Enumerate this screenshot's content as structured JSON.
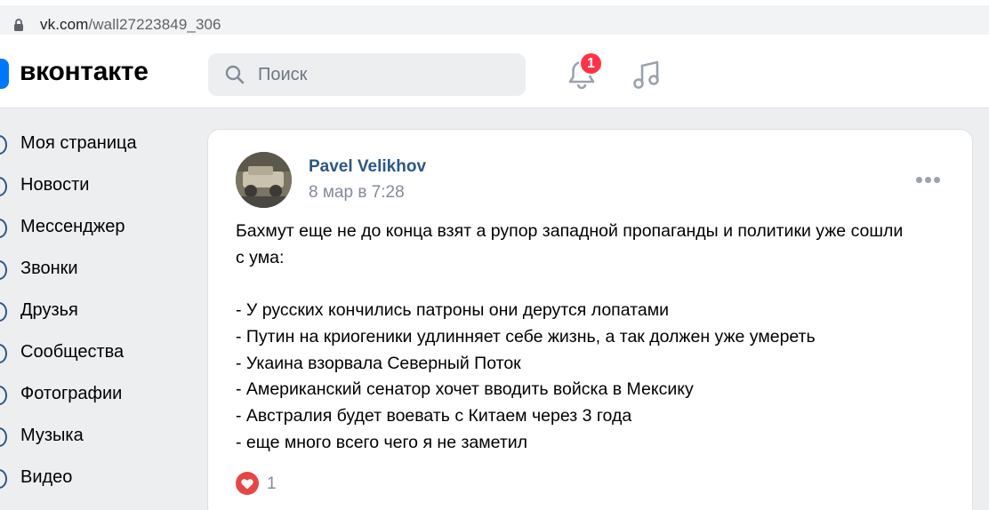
{
  "browser": {
    "url_domain": "vk.com",
    "url_path": "/wall27223849_306"
  },
  "header": {
    "logo_text": "вконтакте",
    "search_placeholder": "Поиск",
    "notifications_badge": "1"
  },
  "sidebar": {
    "items": [
      {
        "label": "Моя страница"
      },
      {
        "label": "Новости"
      },
      {
        "label": "Мессенджер"
      },
      {
        "label": "Звонки"
      },
      {
        "label": "Друзья"
      },
      {
        "label": "Сообщества"
      },
      {
        "label": "Фотографии"
      },
      {
        "label": "Музыка"
      },
      {
        "label": "Видео"
      }
    ]
  },
  "post": {
    "author": "Pavel Velikhov",
    "time": "8 мар в 7:28",
    "lines": [
      "Бахмут еще не до конца взят а рупор западной пропаганды и политики уже сошли",
      "с ума:",
      "",
      "- У русских кончились патроны они дерутся лопатами",
      "- Путин на криогеники удлинняет себе жизнь, а так должен уже умереть",
      "- Укаина взорвала Северный Поток",
      "- Американский сенатор хочет вводить войска в Мексику",
      "- Австралия будет воевать с Китаем через 3 года",
      "- еще много всего чего я не заметил"
    ],
    "likes": "1"
  },
  "colors": {
    "accent": "#2a5885",
    "vk_blue": "#0077ff",
    "like_red": "#e64646",
    "badge_red": "#ff3347"
  }
}
